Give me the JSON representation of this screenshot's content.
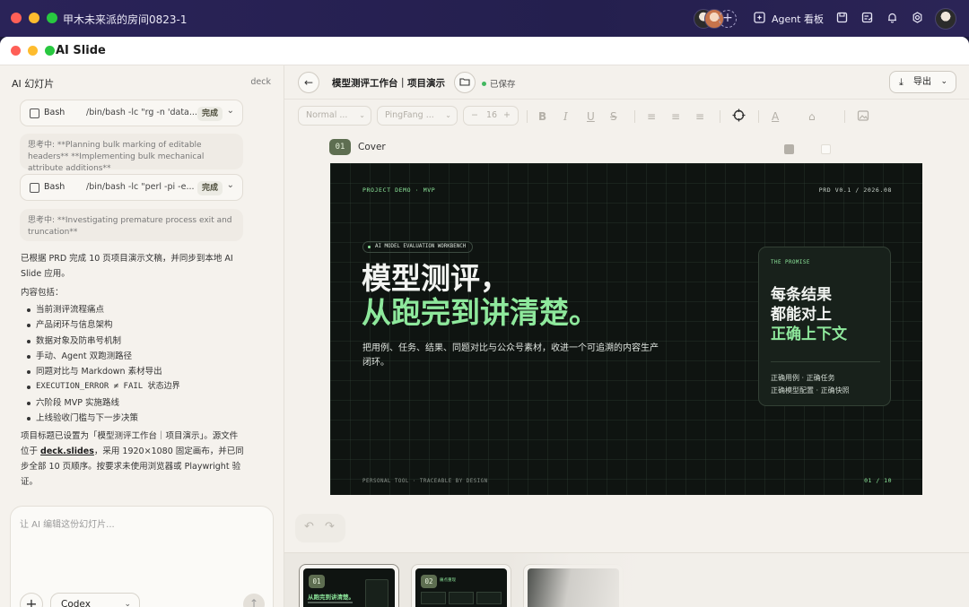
{
  "outer": {
    "title": "甲木未来派的房间0823-1",
    "add_member": "+",
    "kanban_label": "Agent 看板"
  },
  "window": {
    "title": "AI Slide"
  },
  "chat": {
    "header": "AI 幻灯片",
    "deck_label": "deck",
    "tool_calls": [
      {
        "name": "Bash",
        "command": "/bin/bash -lc \"rg -n 'data...",
        "status": "完成"
      },
      {
        "name": "Bash",
        "command": "/bin/bash -lc \"perl -pi -e...",
        "status": "完成"
      }
    ],
    "thinking": [
      "思考中: **Planning bulk marking of editable headers** **Implementing bulk mechanical attribute additions**",
      "思考中: **Investigating premature process exit and truncation**"
    ],
    "summary_intro": "已根据 PRD 完成 10 页项目演示文稿，并同步到本地 AI Slide 应用。",
    "content_heading": "内容包括：",
    "bullets": [
      "当前测评流程痛点",
      "产品闭环与信息架构",
      "数据对象及防串号机制",
      "手动、Agent 双跑测路径",
      "同题对比与 Markdown 素材导出",
      "EXECUTION_ERROR ≠ FAIL 状态边界",
      "六阶段 MVP 实施路线",
      "上线验收门槛与下一步决策"
    ],
    "closing_1": "项目标题已设置为「模型测评工作台｜项目演示」。源文件位于 ",
    "closing_link": "deck.slides",
    "closing_2": "，采用 1920×1080 固定画布，并已同步全部 10 页顺序。按要求未使用浏览器或 Playwright 验证。",
    "composer_placeholder": "让 AI 编辑这份幻灯片...",
    "model": "Codex"
  },
  "editor": {
    "doc_title": "模型测评工作台｜项目演示",
    "saved_status": "已保存",
    "export_label": "导出",
    "toolbar": {
      "style_select": "Normal ...",
      "font_select": "PingFang ...",
      "font_size": "16",
      "minus": "−",
      "plus": "+"
    },
    "slide_number": "01",
    "slide_name": "Cover"
  },
  "slide": {
    "project_tag": "PROJECT DEMO · MVP",
    "version": "PRD V0.1 / 2026.08",
    "pill": "AI MODEL EVALUATION WORKBENCH",
    "headline_1": "模型测评，",
    "headline_2": "从跑完到讲清楚。",
    "description": "把用例、任务、结果、同题对比与公众号素材，收进一个可追溯的内容生产闭环。",
    "footer_left": "PERSONAL TOOL · TRACEABLE BY DESIGN",
    "page": "01 / 10",
    "card": {
      "kicker": "THE PROMISE",
      "line_1": "每条结果",
      "line_2": "都能对上",
      "line_3": "正确上下文",
      "foot_1": "正确用例 · 正确任务",
      "foot_2": "正确模型配置 · 正确快照"
    }
  },
  "thumbnails": [
    {
      "number": "01",
      "title": "从跑完到讲清楚。"
    },
    {
      "number": "02",
      "title": "痛点重现"
    }
  ],
  "colors": {
    "accent_green": "#8ee89c",
    "slide_bg": "#0f1411",
    "tag_bg": "#5e6e51"
  }
}
